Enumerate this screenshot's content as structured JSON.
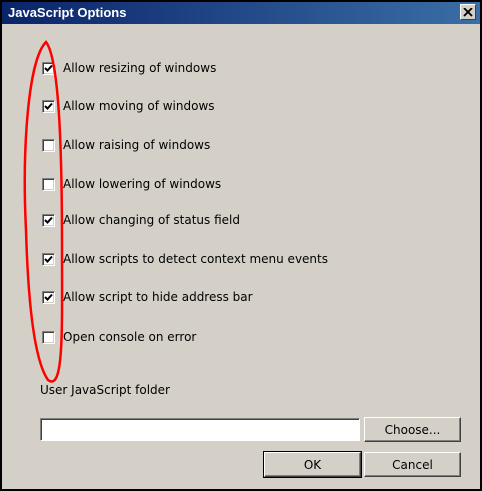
{
  "window": {
    "title": "JavaScript Options",
    "close_label": "×"
  },
  "options": [
    {
      "label": "Allow resizing of windows",
      "checked": true
    },
    {
      "label": "Allow moving of windows",
      "checked": true
    },
    {
      "label": "Allow raising of windows",
      "checked": false
    },
    {
      "label": "Allow lowering of windows",
      "checked": false
    },
    {
      "label": "Allow changing of status field",
      "checked": true
    },
    {
      "label": "Allow scripts to detect context menu events",
      "checked": true
    },
    {
      "label": "Allow script to hide address bar",
      "checked": true
    },
    {
      "label": "Open console on error",
      "checked": false
    }
  ],
  "folder": {
    "label": "User JavaScript folder",
    "value": ""
  },
  "buttons": {
    "choose": "Choose...",
    "ok": "OK",
    "cancel": "Cancel"
  },
  "colors": {
    "title_start": "#0a246a",
    "title_end": "#3a6ea5",
    "dialog_bg": "#d4d0c8",
    "annotation": "#ff0000"
  }
}
